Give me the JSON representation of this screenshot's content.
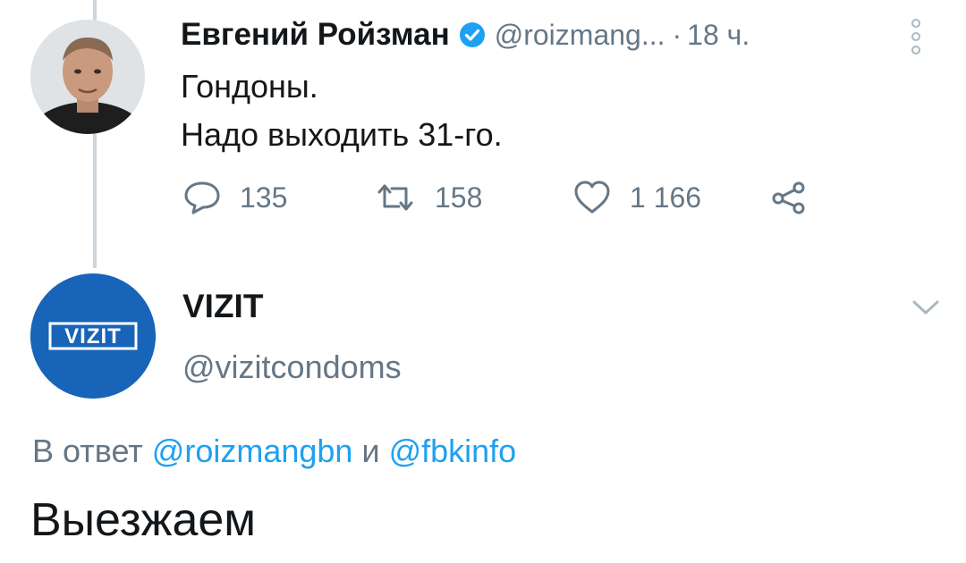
{
  "tweet1": {
    "author_name": "Евгений Ройзман",
    "handle": "@roizmang...",
    "separator": "·",
    "time": "18 ч.",
    "text_line1": "Гондоны.",
    "text_line2": "Надо выходить 31-го.",
    "replies": "135",
    "retweets": "158",
    "likes": "1 166",
    "icons": {
      "verified": "verified-badge-icon",
      "more": "more-vertical-icon",
      "reply": "reply-icon",
      "retweet": "retweet-icon",
      "like": "heart-icon",
      "share": "share-icon"
    }
  },
  "tweet2": {
    "author_name": "VIZIT",
    "handle": "@vizitcondoms",
    "avatar_logo_text": "VIZIT",
    "reply_prefix": "В ответ",
    "mention1": "@roizmangbn",
    "conjunction": "и",
    "mention2": "@fbkinfo",
    "text": "Выезжаем",
    "icons": {
      "menu": "chevron-down-icon"
    }
  },
  "colors": {
    "text_primary": "#14171a",
    "text_secondary": "#657786",
    "link": "#1da1f2",
    "verified": "#1da1f2",
    "thread_line": "#ccd6dd",
    "vizit_brand": "#1864b8"
  }
}
